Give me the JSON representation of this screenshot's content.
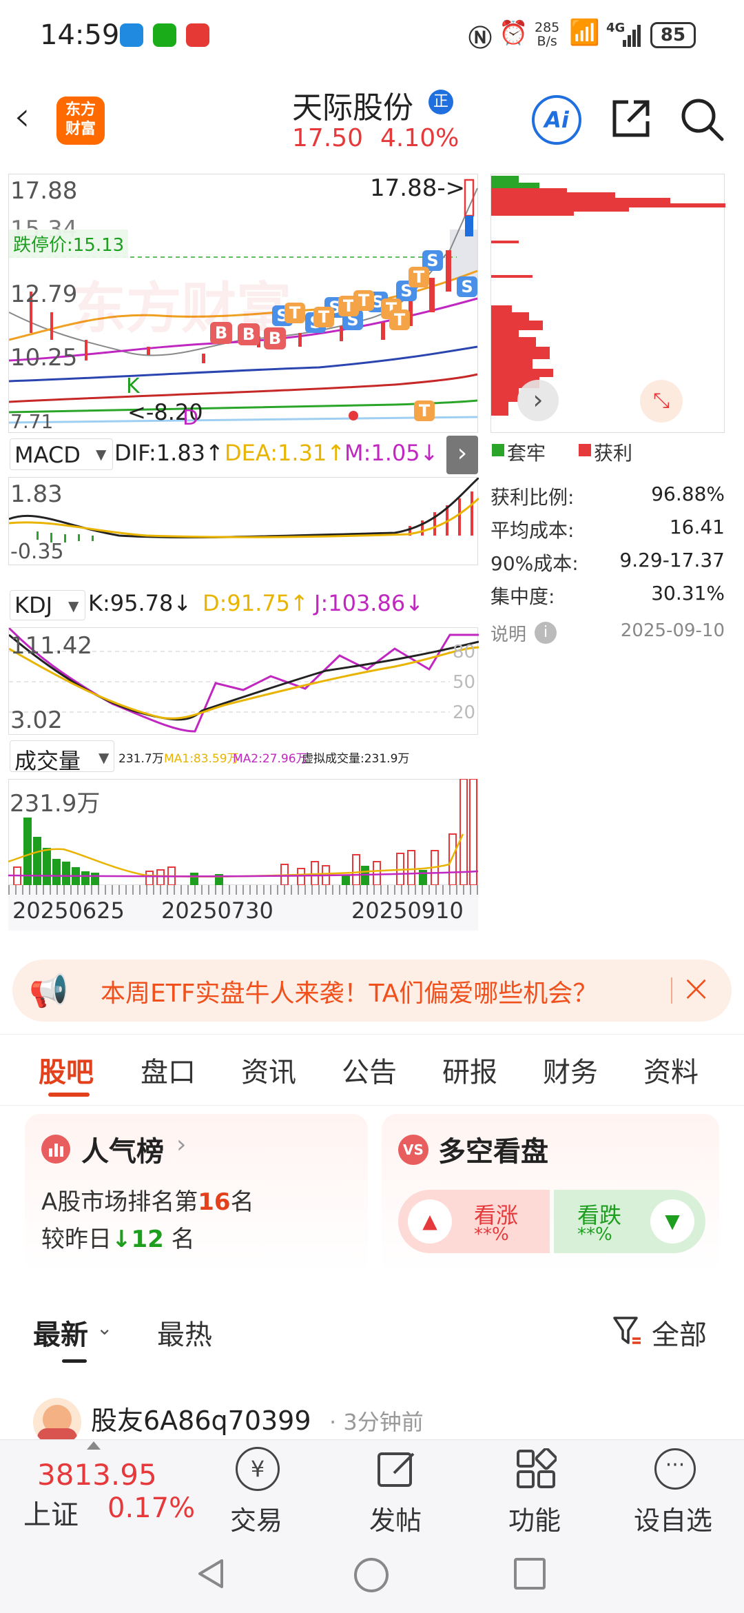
{
  "status_bar": {
    "time": "14:59",
    "net_speed_top": "285",
    "net_speed_bottom": "B/s",
    "network": "4G",
    "battery": "85"
  },
  "header": {
    "logo_line1": "东方",
    "logo_line2": "财富",
    "title": "天际股份",
    "badge": "正",
    "price": "17.50",
    "change_pct": "4.10%",
    "ai_label": "Ai"
  },
  "kline": {
    "high_label": "17.88",
    "high_arrow_label": "17.88->",
    "limit_down_label": "跌停价:15.13",
    "y_labels": [
      "15.34",
      "12.79",
      "10.25",
      "7.71"
    ],
    "low_arrow_label": "<-8.20",
    "k_marker": "K",
    "d_marker": "D",
    "watermark": "东方财富",
    "markers": [
      "B",
      "B",
      "B",
      "S",
      "S",
      "S",
      "S",
      "S",
      "S",
      "S",
      "S",
      "T",
      "T",
      "T",
      "T",
      "T",
      "T",
      "T",
      "T"
    ]
  },
  "macd": {
    "name": "MACD",
    "dif": "DIF:1.83↑",
    "dea": "DEA:1.31↑",
    "m": "M:1.05↓",
    "y_top": "1.83",
    "y_bottom": "-0.35"
  },
  "kdj": {
    "name": "KDJ",
    "k": "K:95.78↓",
    "d": "D:91.75↑",
    "j": "J:103.86↓",
    "y_top": "111.42",
    "y_bottom": "3.02",
    "levels": [
      "80",
      "50",
      "20"
    ]
  },
  "volume": {
    "name": "成交量",
    "vol": "231.7万",
    "ma1": "MA1:83.59万",
    "ma2": "MA2:27.96万",
    "virtual": "虚拟成交量:231.9万",
    "y_top": "231.9万",
    "dates": [
      "20250625",
      "20250730",
      "20250910"
    ]
  },
  "chip": {
    "legend": [
      {
        "label": "套牢",
        "color": "#2aa52a"
      },
      {
        "label": "获利",
        "color": "#e5393b"
      }
    ],
    "stats": [
      {
        "label": "获利比例:",
        "value": "96.88%"
      },
      {
        "label": "平均成本:",
        "value": "16.41"
      },
      {
        "label": "90%成本:",
        "value": "9.29-17.37"
      },
      {
        "label": "集中度:",
        "value": "30.31%"
      }
    ],
    "note_label": "说明",
    "date": "2025-09-10"
  },
  "banner": {
    "text": "本周ETF实盘牛人来袭！TA们偏爱哪些机会？"
  },
  "tabs": [
    "股吧",
    "盘口",
    "资讯",
    "公告",
    "研报",
    "财务",
    "资料"
  ],
  "popularity": {
    "title": "人气榜",
    "line1_prefix": "A股市场排名第",
    "rank": "16",
    "line1_suffix": "名",
    "line2_prefix": "较昨日",
    "change": "12",
    "line2_suffix": "名"
  },
  "vote": {
    "title": "多空看盘",
    "up_label": "看涨",
    "up_pct": "**%",
    "down_label": "看跌",
    "down_pct": "**%"
  },
  "feed": {
    "sort_latest": "最新",
    "sort_hot": "最热",
    "filter": "全部",
    "post_user": "股友6A86q70399",
    "post_time": "3分钟前"
  },
  "bottom_bar": {
    "index_value": "3813.95",
    "index_name": "上证",
    "index_change": "0.17%",
    "items": [
      "交易",
      "发帖",
      "功能",
      "设自选"
    ]
  },
  "colors": {
    "up": "#e5393b",
    "down": "#1e9e1e",
    "accent": "#ff6a00",
    "brand_blue": "#1f6fde"
  }
}
